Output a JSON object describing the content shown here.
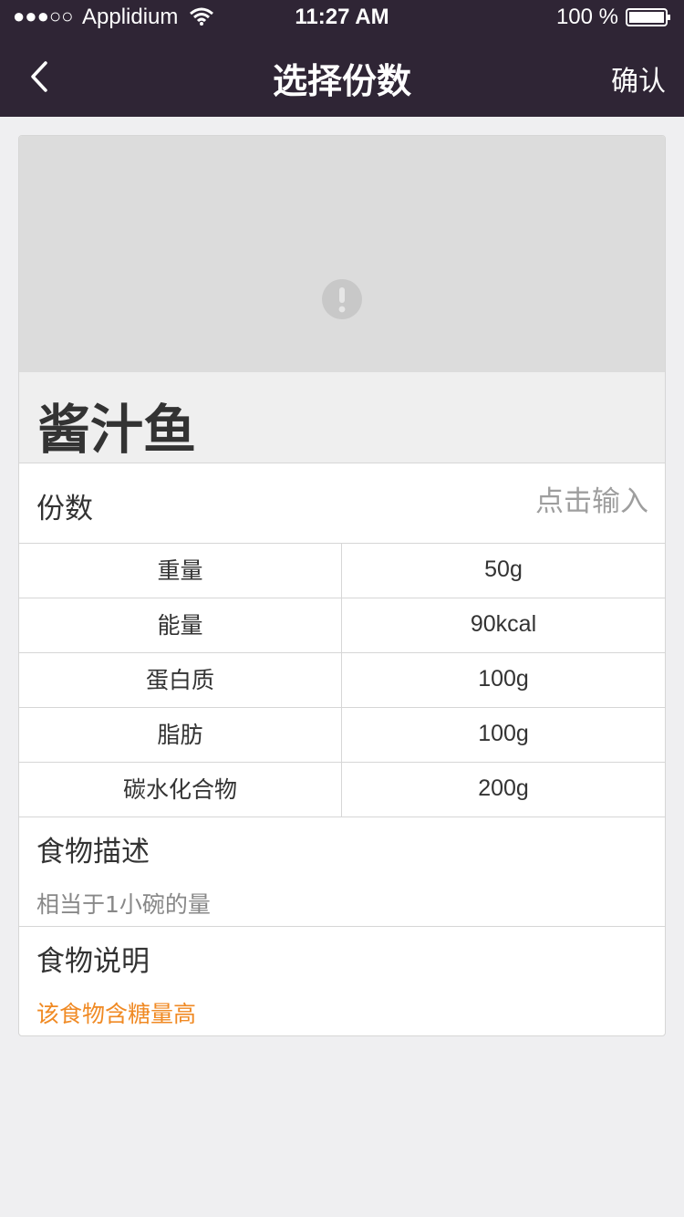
{
  "status_bar": {
    "signal": "●●●○○",
    "carrier": "Applidium",
    "time": "11:27 AM",
    "battery": "100 %"
  },
  "nav": {
    "back_icon": "chevron-left-icon",
    "title": "选择份数",
    "confirm": "确认"
  },
  "food": {
    "image_placeholder_icon": "exclamation-icon",
    "name": "酱汁鱼"
  },
  "portion": {
    "label": "份数",
    "placeholder": "点击输入",
    "value": ""
  },
  "nutrition": [
    {
      "name": "重量",
      "value": "50g"
    },
    {
      "name": "能量",
      "value": "90kcal"
    },
    {
      "name": "蛋白质",
      "value": "100g"
    },
    {
      "name": "脂肪",
      "value": "100g"
    },
    {
      "name": "碳水化合物",
      "value": "200g"
    }
  ],
  "description": {
    "title": "食物描述",
    "text": "相当于1小碗的量"
  },
  "note": {
    "title": "食物说明",
    "text": "该食物含糖量高"
  },
  "colors": {
    "header_bg": "#2f2535",
    "page_bg": "#efeff1",
    "accent_orange": "#f08a24"
  }
}
